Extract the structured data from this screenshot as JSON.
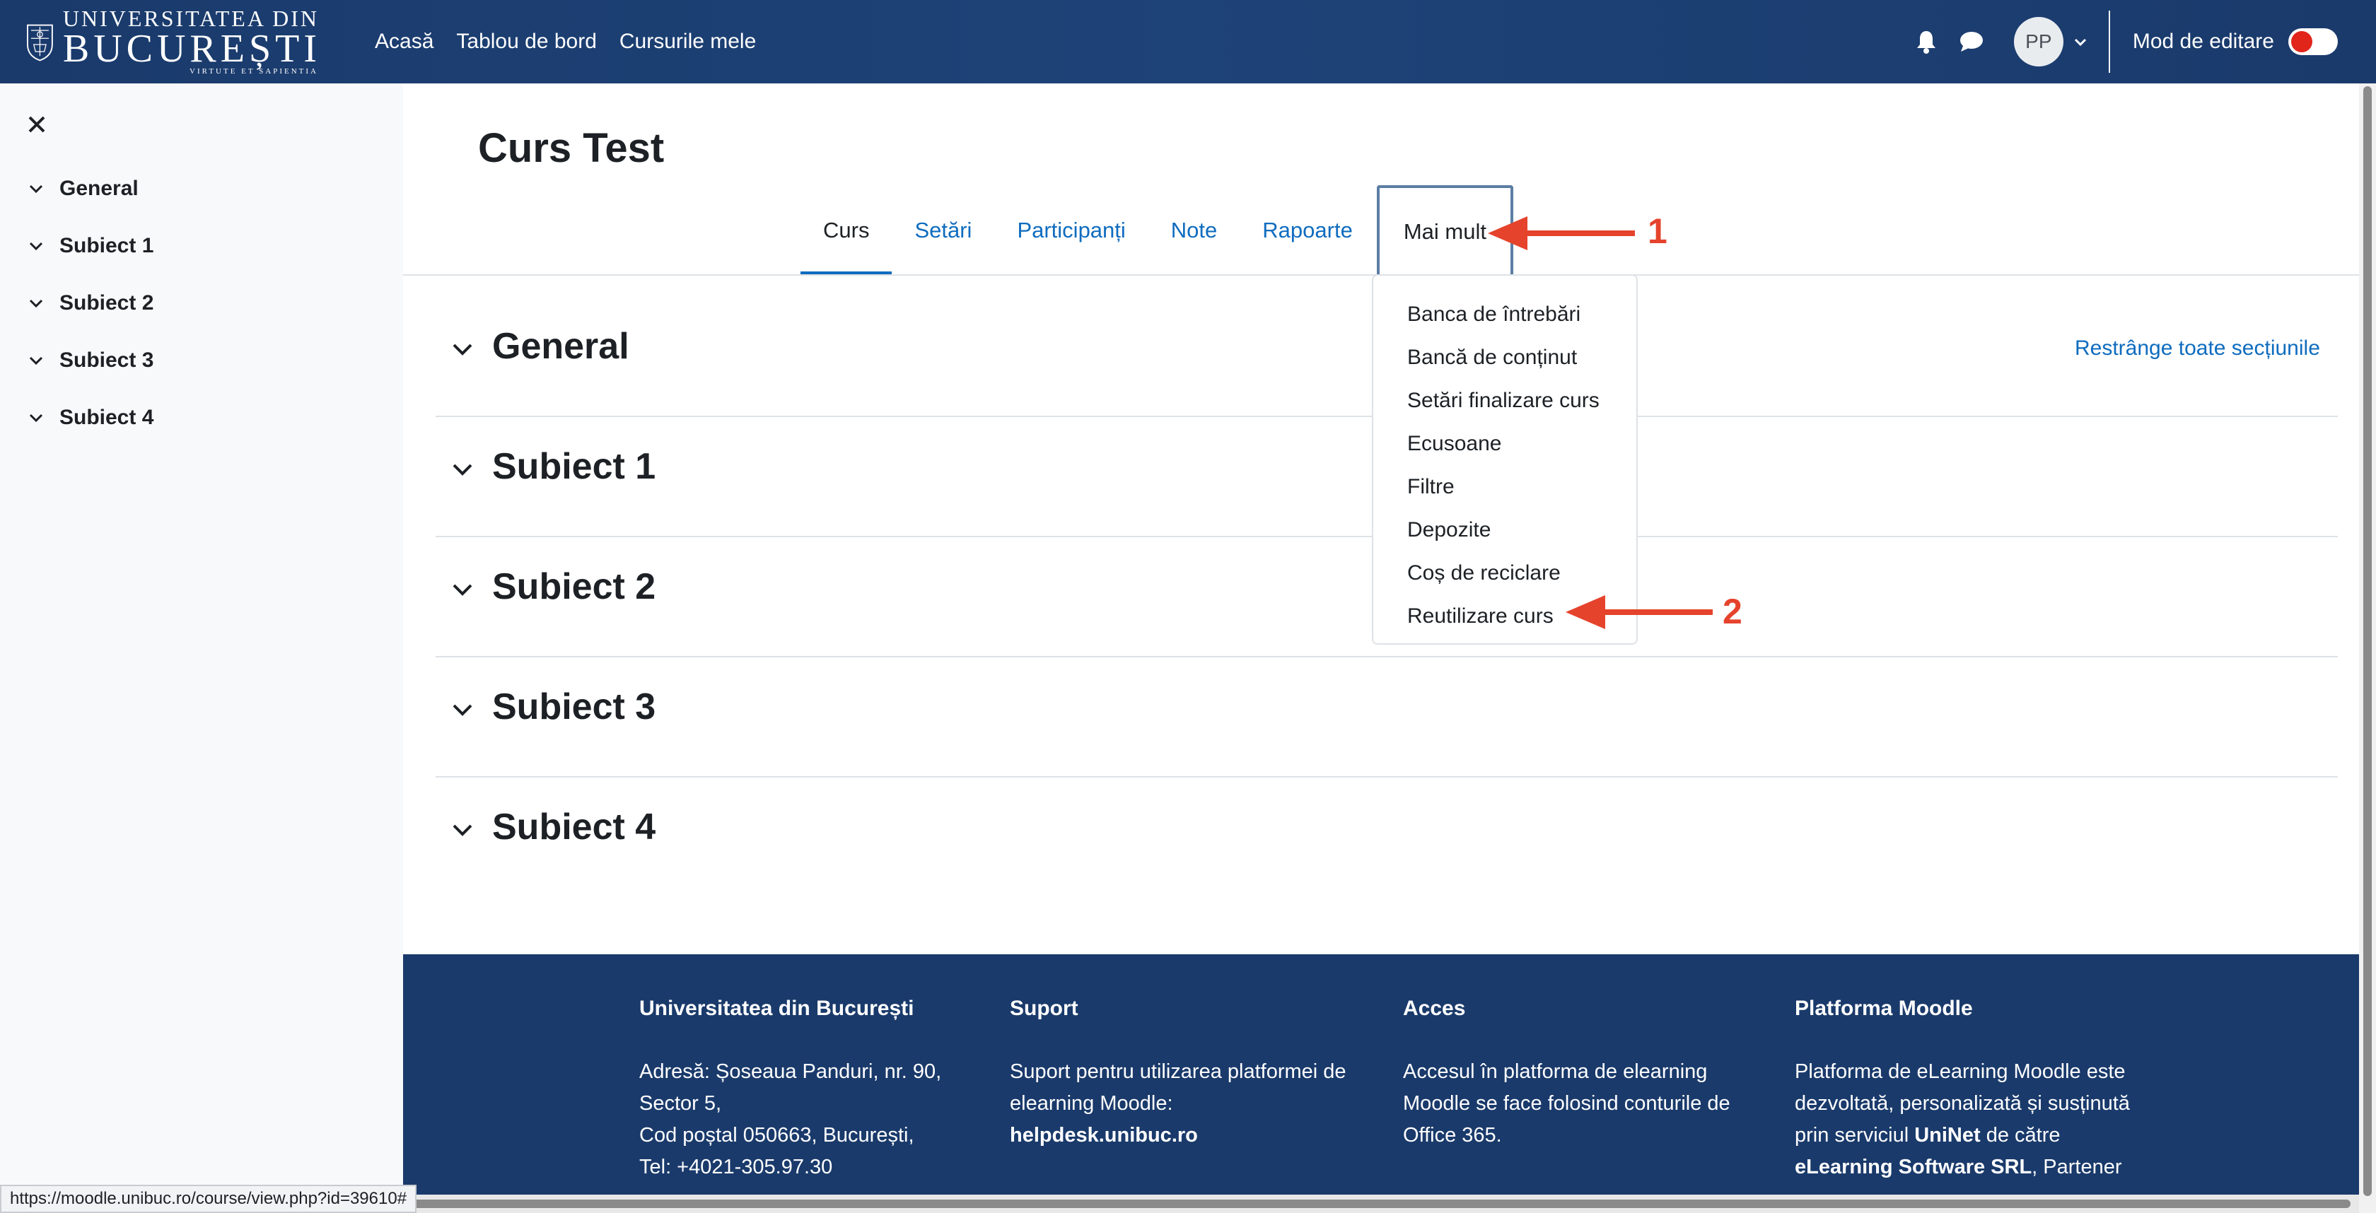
{
  "brand": {
    "line1": "UNIVERSITATEA DIN",
    "line2": "BUCUREȘTI",
    "motto": "VIRTUTE ET SAPIENTIA"
  },
  "nav": {
    "links": [
      "Acasă",
      "Tablou de bord",
      "Cursurile mele"
    ],
    "avatar_initials": "PP",
    "edit_mode_label": "Mod de editare",
    "edit_mode_on": false
  },
  "sidebar": {
    "items": [
      "General",
      "Subiect 1",
      "Subiect 2",
      "Subiect 3",
      "Subiect 4"
    ]
  },
  "course": {
    "title": "Curs Test",
    "tabs": [
      "Curs",
      "Setări",
      "Participanți",
      "Note",
      "Rapoarte",
      "Mai mult"
    ],
    "collapse_all": "Restrânge toate secțiunile",
    "sections": [
      "General",
      "Subiect 1",
      "Subiect 2",
      "Subiect 3",
      "Subiect 4"
    ]
  },
  "more_menu": {
    "items": [
      "Banca de întrebări",
      "Bancă de conținut",
      "Setări finalizare curs",
      "Ecusoane",
      "Filtre",
      "Depozite",
      "Coș de reciclare",
      "Reutilizare curs"
    ]
  },
  "annotations": {
    "arrow_1": "1",
    "arrow_2": "2",
    "color": "#e5432c"
  },
  "footer": {
    "col1": {
      "heading": "Universitatea din București",
      "line1": "Adresă: Șoseaua Panduri, nr. 90,",
      "line2": "Sector 5,",
      "line3": "Cod poștal 050663, București,",
      "line4": "Tel: +4021-305.97.30"
    },
    "col2": {
      "heading": "Suport",
      "line1": "Suport pentru utilizarea platformei de",
      "line2": "elearning Moodle:",
      "line3": "helpdesk.unibuc.ro"
    },
    "col3": {
      "heading": "Acces",
      "line1": "Accesul în platforma de elearning",
      "line2": "Moodle se face folosind conturile de",
      "line3": "Office 365."
    },
    "col4": {
      "heading": "Platforma Moodle",
      "line1": "Platforma de eLearning Moodle este",
      "line2": "dezvoltată, personalizată și susținută",
      "line3a": "prin serviciul ",
      "line3b": "UniNet",
      "line3c": " de către",
      "line4a": "eLearning Software SRL",
      "line4b": ", Partener"
    }
  },
  "status_bar": {
    "url": "https://moodle.unibuc.ro/course/view.php?id=39610#"
  },
  "colors": {
    "navbar": "#1a3a6b",
    "link": "#0f6cbf",
    "annotation": "#e5432c",
    "toggle_knob": "#e1251b"
  }
}
